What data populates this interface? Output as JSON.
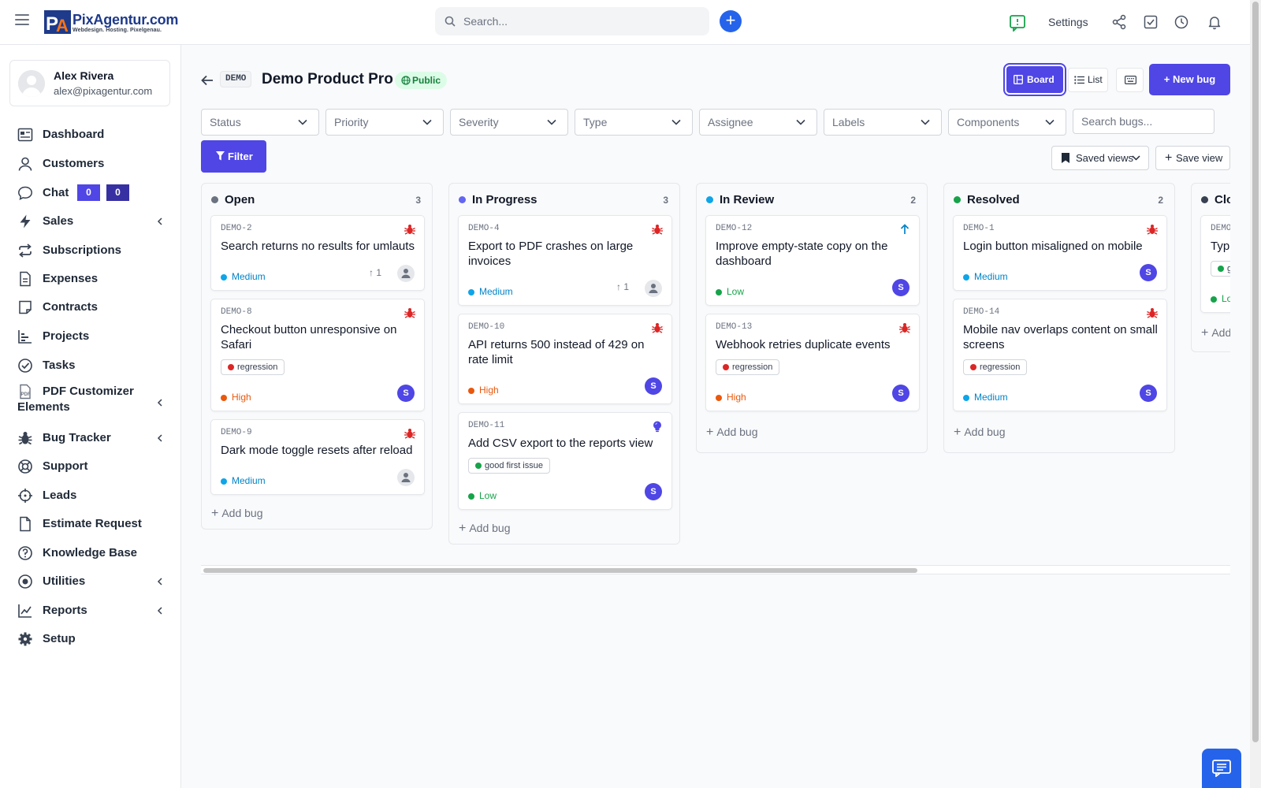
{
  "topbar": {
    "brand_name": "PixAgentur.com",
    "brand_tagline": "Webdesign. Hosting. Pixelgenau.",
    "logo_letters": "PA",
    "search_placeholder": "Search...",
    "settings_label": "Settings"
  },
  "user": {
    "name": "Alex Rivera",
    "email": "alex@pixagentur.com"
  },
  "sidebar": {
    "items": [
      {
        "label": "Dashboard",
        "icon": "dashboard-icon"
      },
      {
        "label": "Customers",
        "icon": "user-icon"
      },
      {
        "label": "Chat",
        "icon": "chat-icon",
        "badges": [
          "0",
          "0"
        ]
      },
      {
        "label": "Sales",
        "icon": "bolt-icon",
        "submenu": true
      },
      {
        "label": "Subscriptions",
        "icon": "repeat-icon"
      },
      {
        "label": "Expenses",
        "icon": "file-icon"
      },
      {
        "label": "Contracts",
        "icon": "note-icon"
      },
      {
        "label": "Projects",
        "icon": "chart-bar-icon"
      },
      {
        "label": "Tasks",
        "icon": "check-circle-icon"
      },
      {
        "label": "PDF Customizer Elements",
        "icon": "pdf-icon",
        "submenu": true
      },
      {
        "label": "Bug Tracker",
        "icon": "bug-icon",
        "submenu": true
      },
      {
        "label": "Support",
        "icon": "lifebuoy-icon"
      },
      {
        "label": "Leads",
        "icon": "crosshair-icon"
      },
      {
        "label": "Estimate Request",
        "icon": "file-icon"
      },
      {
        "label": "Knowledge Base",
        "icon": "question-circle-icon"
      },
      {
        "label": "Utilities",
        "icon": "dot-circle-icon",
        "submenu": true
      },
      {
        "label": "Reports",
        "icon": "line-chart-icon",
        "submenu": true
      },
      {
        "label": "Setup",
        "icon": "gear-icon"
      }
    ]
  },
  "project": {
    "key": "DEMO",
    "name": "Demo Product Pro",
    "visibility": "Public"
  },
  "toolbar": {
    "board_label": "Board",
    "list_label": "List",
    "new_bug_label": "New bug",
    "filter_label": "Filter",
    "saved_views_label": "Saved views",
    "save_view_label": "Save view",
    "search_bugs_placeholder": "Search bugs..."
  },
  "filters": [
    "Status",
    "Priority",
    "Severity",
    "Type",
    "Assignee",
    "Labels",
    "Components"
  ],
  "board": {
    "add_bug_label": "Add bug",
    "columns": [
      {
        "title": "Open",
        "count": "3",
        "color": "#6b7280",
        "cards": [
          {
            "key": "DEMO-2",
            "title": "Search returns no results for umlauts",
            "type": "bug",
            "priority": "Medium",
            "votes": "1",
            "assignee": ""
          },
          {
            "key": "DEMO-8",
            "title": "Checkout button unresponsive on Safari",
            "type": "bug",
            "label": "regression",
            "priority": "High",
            "assignee": "S"
          },
          {
            "key": "DEMO-9",
            "title": "Dark mode toggle resets after reload",
            "type": "bug",
            "priority": "Medium",
            "assignee": ""
          }
        ]
      },
      {
        "title": "In Progress",
        "count": "3",
        "color": "#6366f1",
        "cards": [
          {
            "key": "DEMO-4",
            "title": "Export to PDF crashes on large invoices",
            "type": "bug",
            "priority": "Medium",
            "votes": "1",
            "assignee": ""
          },
          {
            "key": "DEMO-10",
            "title": "API returns 500 instead of 429 on rate limit",
            "type": "bug",
            "priority": "High",
            "assignee": "S"
          },
          {
            "key": "DEMO-11",
            "title": "Add CSV export to the reports view",
            "type": "feature",
            "label": "good first issue",
            "priority": "Low",
            "assignee": "S"
          }
        ]
      },
      {
        "title": "In Review",
        "count": "2",
        "color": "#0ea5e9",
        "cards": [
          {
            "key": "DEMO-12",
            "title": "Improve empty-state copy on the dashboard",
            "type": "improvement",
            "priority": "Low",
            "assignee": "S"
          },
          {
            "key": "DEMO-13",
            "title": "Webhook retries duplicate events",
            "type": "bug",
            "label": "regression",
            "priority": "High",
            "assignee": "S"
          }
        ]
      },
      {
        "title": "Resolved",
        "count": "2",
        "color": "#16a34a",
        "cards": [
          {
            "key": "DEMO-1",
            "title": "Login button misaligned on mobile",
            "type": "bug",
            "priority": "Medium",
            "assignee": "S"
          },
          {
            "key": "DEMO-14",
            "title": "Mobile nav overlaps content on small screens",
            "type": "bug",
            "label": "regression",
            "priority": "Medium",
            "assignee": "S"
          }
        ]
      },
      {
        "title": "Clo",
        "color": "#374151",
        "cards": [
          {
            "key": "DEMO",
            "title": "Typ",
            "label": "g",
            "priority": "Lo"
          }
        ],
        "add_bug_label": "Add"
      }
    ]
  },
  "colors": {
    "accent": "#4f46e5",
    "priority_medium": "#0ea5e9",
    "priority_high": "#ea580c",
    "priority_low": "#16a34a",
    "label_regression": "#dc2626",
    "label_good_first_issue": "#16a34a"
  }
}
